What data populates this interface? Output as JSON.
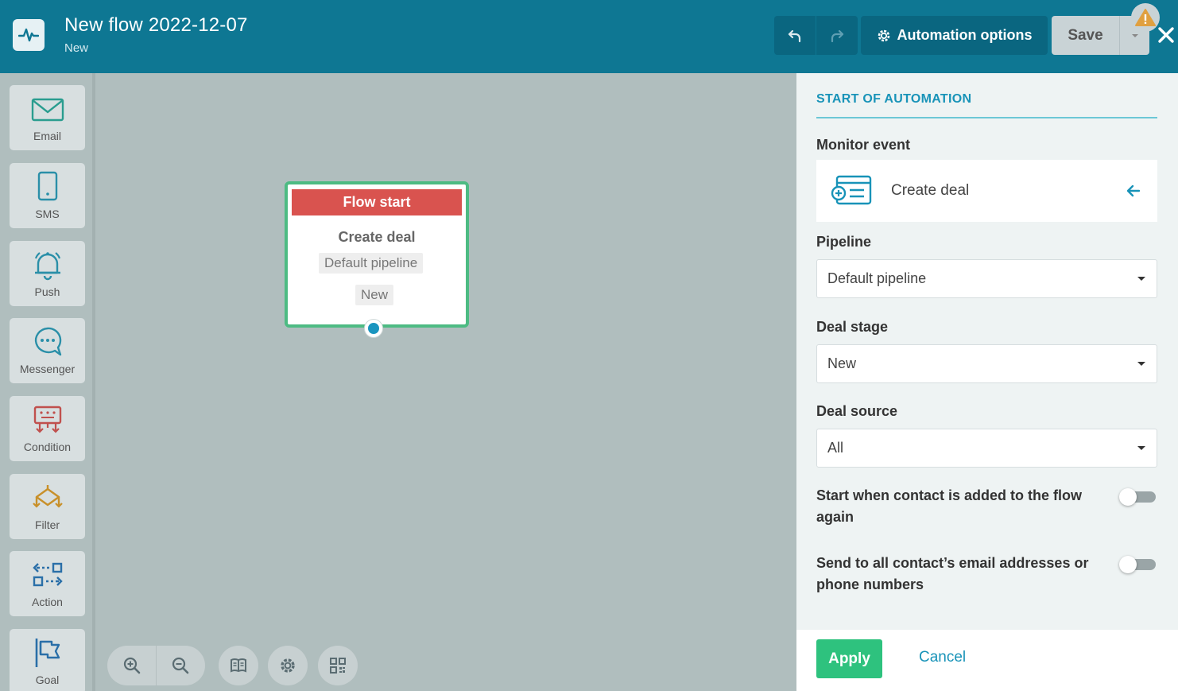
{
  "header": {
    "title": "New flow 2022-12-07",
    "status": "New",
    "automation_options_label": "Automation options",
    "save_label": "Save"
  },
  "palette": {
    "items": [
      {
        "label": "Email",
        "icon": "email-icon",
        "color": "#2a9d8f"
      },
      {
        "label": "SMS",
        "icon": "sms-icon",
        "color": "#2a8fa8"
      },
      {
        "label": "Push",
        "icon": "push-bell-icon",
        "color": "#2a8fa8"
      },
      {
        "label": "Messenger",
        "icon": "messenger-icon",
        "color": "#2a8fa8"
      },
      {
        "label": "Condition",
        "icon": "condition-icon",
        "color": "#c0504d"
      },
      {
        "label": "Filter",
        "icon": "filter-icon",
        "color": "#c8902a"
      },
      {
        "label": "Action",
        "icon": "action-icon",
        "color": "#2a6fa8"
      },
      {
        "label": "Goal",
        "icon": "goal-flag-icon",
        "color": "#2a6fa8"
      }
    ]
  },
  "node": {
    "header": "Flow start",
    "event": "Create deal",
    "pipeline": "Default pipeline",
    "stage": "New"
  },
  "panel": {
    "title": "START OF AUTOMATION",
    "monitor_event_label": "Monitor event",
    "monitor_event_value": "Create deal",
    "pipeline_label": "Pipeline",
    "pipeline_value": "Default pipeline",
    "deal_stage_label": "Deal stage",
    "deal_stage_value": "New",
    "deal_source_label": "Deal source",
    "deal_source_value": "All",
    "toggle_readd_label": "Start when contact is added to the flow again",
    "toggle_readd_on": false,
    "toggle_all_contacts_label": "Send to all contact’s email addresses or phone numbers",
    "toggle_all_contacts_on": false
  },
  "footer": {
    "apply_label": "Apply",
    "cancel_label": "Cancel"
  },
  "colors": {
    "header_bg": "#0e7793",
    "accent": "#1893b8",
    "flow_start": "#d9534f",
    "node_border": "#4dbb83",
    "apply": "#2ec27e"
  }
}
